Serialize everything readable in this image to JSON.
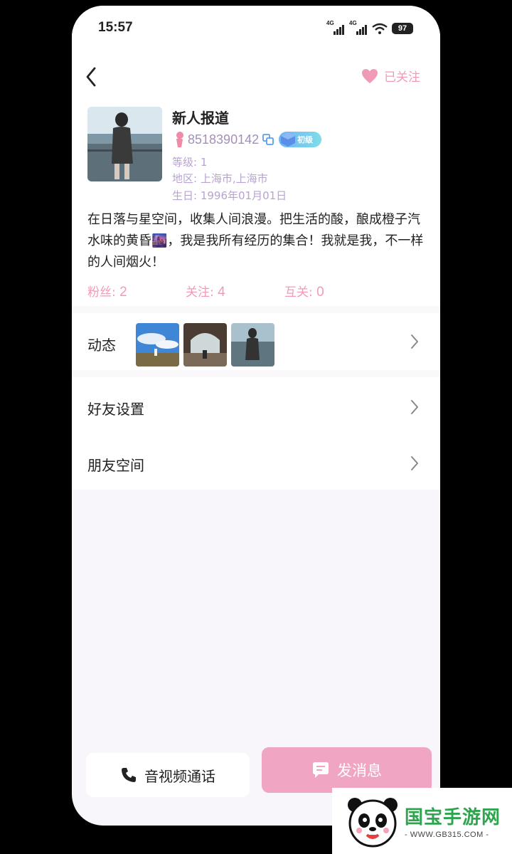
{
  "status_bar": {
    "time": "15:57",
    "signal1": "4G",
    "signal2": "4G",
    "battery": "97"
  },
  "header": {
    "follow_label": "已关注"
  },
  "profile": {
    "name": "新人报道",
    "id": "8518390142",
    "badge": "初级",
    "level": "等级: 1",
    "region": "地区: 上海市,上海市",
    "birthday": "生日: 1996年01月01日",
    "bio": "在日落与星空间，收集人间浪漫。把生活的酸，酿成橙子汽水味的黄昏🌆，我是我所有经历的集合！我就是我，不一样的人间烟火！"
  },
  "stats": [
    {
      "label": "粉丝:",
      "value": "2"
    },
    {
      "label": "关注:",
      "value": "4"
    },
    {
      "label": "互关:",
      "value": "0"
    }
  ],
  "menu": {
    "moments_label": "动态",
    "friend_settings_label": "好友设置",
    "friend_space_label": "朋友空间"
  },
  "actions": {
    "call_label": "音视频通话",
    "message_label": "发消息"
  },
  "watermark": {
    "title": "国宝手游网",
    "url": "- WWW.GB315.COM -"
  },
  "colors": {
    "pink": "#f19ab8",
    "message_button": "#f0a6c3",
    "meta_purple": "#b9a3d2"
  }
}
